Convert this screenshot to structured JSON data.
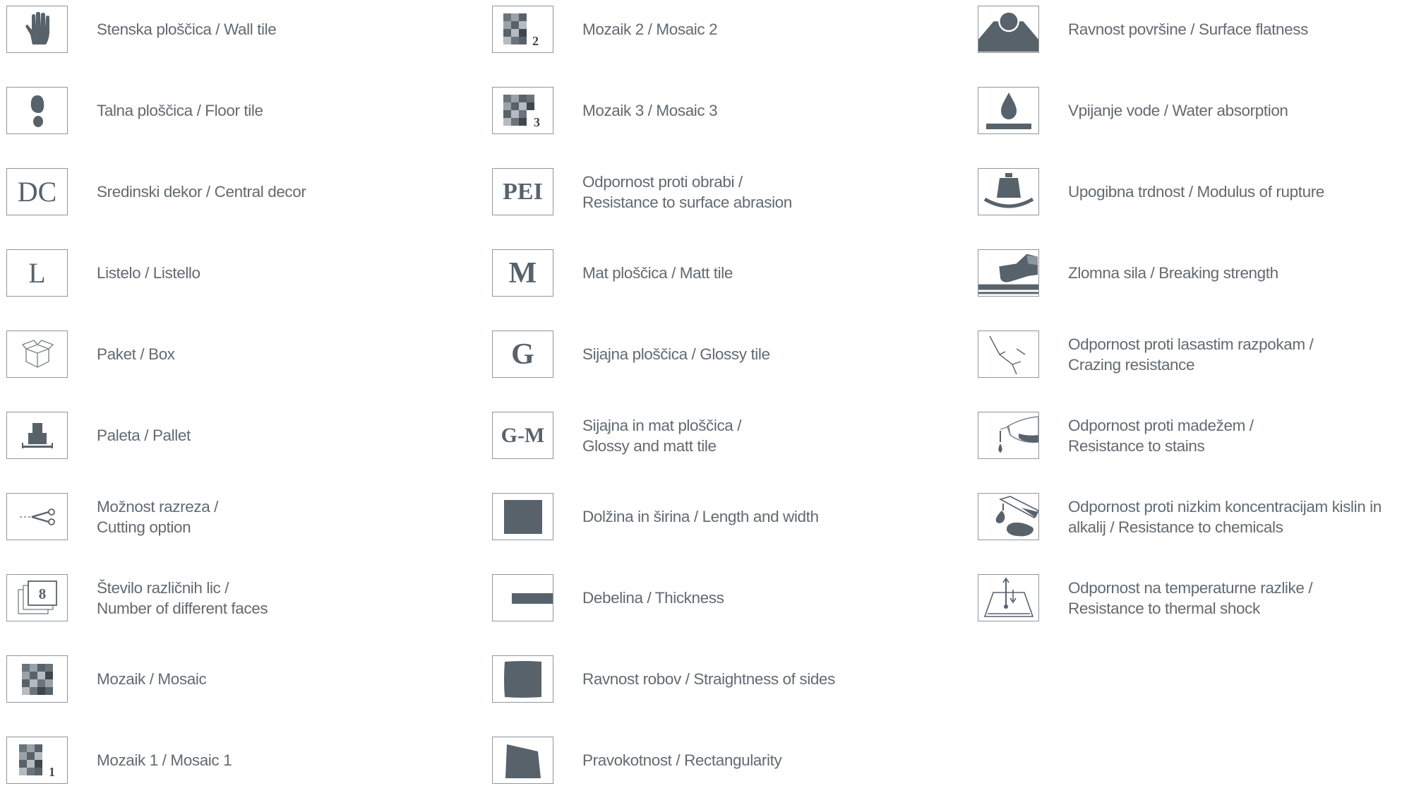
{
  "icon_color": "#58626b",
  "border_color": "#8f979e",
  "text_color": "#626a71",
  "col1": [
    {
      "icon": "hand-icon",
      "lines": [
        "Stenska ploščica / Wall tile"
      ]
    },
    {
      "icon": "footprint-icon",
      "lines": [
        "Talna ploščica / Floor tile"
      ]
    },
    {
      "icon": "dc-letters-icon",
      "glyph": "DC",
      "lines": [
        "Sredinski dekor / Central decor"
      ]
    },
    {
      "icon": "l-letter-icon",
      "glyph": "L",
      "lines": [
        "Listelo / Listello"
      ]
    },
    {
      "icon": "box-icon",
      "lines": [
        "Paket / Box"
      ]
    },
    {
      "icon": "pallet-icon",
      "lines": [
        "Paleta / Pallet"
      ]
    },
    {
      "icon": "scissors-icon",
      "lines": [
        "Možnost razreza /",
        "Cutting option"
      ]
    },
    {
      "icon": "faces-icon",
      "glyph": "8",
      "lines": [
        "Število različnih lic /",
        "Number of different faces"
      ]
    },
    {
      "icon": "mosaic-icon",
      "lines": [
        "Mozaik / Mosaic"
      ]
    },
    {
      "icon": "mosaic-1-icon",
      "glyph": "1",
      "lines": [
        "Mozaik 1 / Mosaic 1"
      ]
    }
  ],
  "col2": [
    {
      "icon": "mosaic-2-icon",
      "glyph": "2",
      "lines": [
        "Mozaik 2 / Mosaic 2"
      ]
    },
    {
      "icon": "mosaic-3-icon",
      "glyph": "3",
      "lines": [
        "Mozaik 3 / Mosaic 3"
      ]
    },
    {
      "icon": "pei-letters-icon",
      "glyph": "PEI",
      "lines": [
        "Odpornost proti obrabi /",
        "Resistance to surface abrasion"
      ]
    },
    {
      "icon": "m-letter-icon",
      "glyph": "M",
      "lines": [
        "Mat ploščica / Matt tile"
      ]
    },
    {
      "icon": "g-letter-icon",
      "glyph": "G",
      "lines": [
        "Sijajna ploščica / Glossy tile"
      ]
    },
    {
      "icon": "gm-letters-icon",
      "glyph": "G-M",
      "lines": [
        "Sijajna in mat ploščica /",
        "Glossy and matt tile"
      ]
    },
    {
      "icon": "square-icon",
      "lines": [
        "Dolžina in širina / Length and width"
      ]
    },
    {
      "icon": "thickness-bar-icon",
      "lines": [
        "Debelina / Thickness"
      ]
    },
    {
      "icon": "straight-sides-icon",
      "lines": [
        "Ravnost robov / Straightness of sides"
      ]
    },
    {
      "icon": "rectangularity-icon",
      "lines": [
        "Pravokotnost / Rectangularity"
      ]
    }
  ],
  "col3": [
    {
      "icon": "surface-flatness-icon",
      "lines": [
        "Ravnost površine / Surface flatness"
      ]
    },
    {
      "icon": "water-drop-icon",
      "lines": [
        "Vpijanje vode / Water absorption"
      ]
    },
    {
      "icon": "weight-icon",
      "lines": [
        "Upogibna trdnost / Modulus of rupture"
      ]
    },
    {
      "icon": "breaking-foot-icon",
      "lines": [
        "Zlomna sila / Breaking strength"
      ]
    },
    {
      "icon": "crack-icon",
      "lines": [
        "Odpornost proti lasastim razpokam /",
        "Crazing resistance"
      ]
    },
    {
      "icon": "stain-pour-icon",
      "lines": [
        "Odpornost proti madežem /",
        "Resistance to stains"
      ]
    },
    {
      "icon": "chemical-pour-icon",
      "lines": [
        "Odpornost proti nizkim koncentracijam kislin in",
        "alkalij / Resistance to chemicals"
      ]
    },
    {
      "icon": "thermal-shock-icon",
      "lines": [
        "Odpornost na temperaturne razlike /",
        "Resistance to thermal shock"
      ]
    }
  ]
}
